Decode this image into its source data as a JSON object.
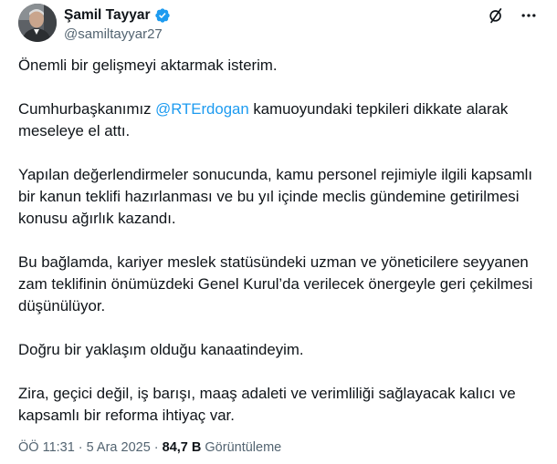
{
  "author": {
    "display_name": "Şamil Tayyar",
    "handle": "@samiltayyar27",
    "verified_icon": "verified-badge-icon"
  },
  "header_actions": {
    "grok_icon": "grok-slash-icon",
    "more_icon": "more-dots-icon"
  },
  "tweet": {
    "p1": "Önemli bir gelişmeyi aktarmak isterim.",
    "p2_before": "Cumhurbaşkanımız ",
    "p2_mention": "@RTErdogan",
    "p2_after": " kamuoyundaki tepkileri dikkate alarak meseleye el attı.",
    "p3": "Yapılan değerlendirmeler sonucunda, kamu personel rejimiyle ilgili kapsamlı bir kanun teklifi hazırlanması ve bu yıl içinde meclis gündemine getirilmesi konusu ağırlık kazandı.",
    "p4": "Bu bağlamda, kariyer meslek statüsündeki uzman ve yöneticilere seyyanen zam teklifinin önümüzdeki Genel Kurul’da verilecek önergeyle geri çekilmesi düşünülüyor.",
    "p5": "Doğru bir yaklaşım olduğu kanaatindeyim.",
    "p6": "Zira, geçici değil, iş barışı, maaş adaleti ve verimliliği sağlayacak kalıcı ve kapsamlı bir reforma ihtiyaç var."
  },
  "meta": {
    "time": "ÖÖ 11:31",
    "separator": "·",
    "date": "5 Ara 2025",
    "views_count": "84,7 B",
    "views_label": "Görüntüleme"
  },
  "colors": {
    "text": "#0f1419",
    "secondary": "#536471",
    "link": "#1d9bf0",
    "verified": "#1d9bf0"
  }
}
